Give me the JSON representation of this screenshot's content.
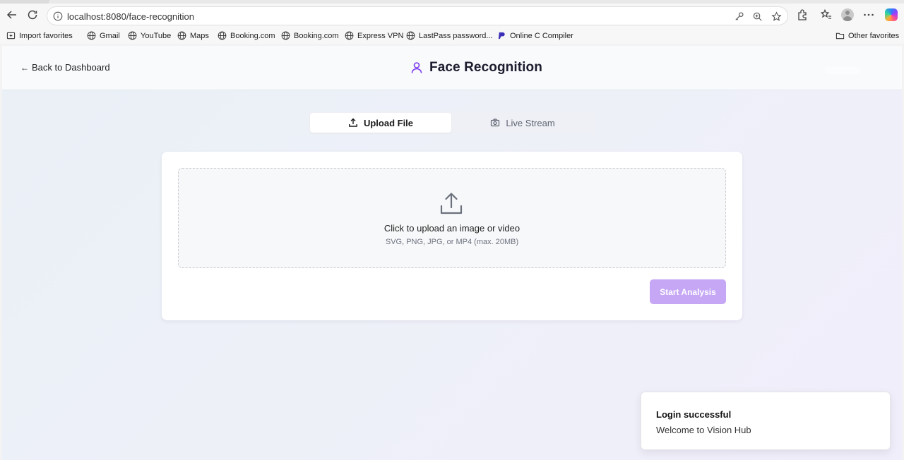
{
  "browser": {
    "url": "localhost:8080/face-recognition",
    "bookmarks": [
      {
        "label": "Import favorites",
        "icon": "import-icon"
      },
      {
        "label": "Gmail",
        "icon": "globe-icon"
      },
      {
        "label": "YouTube",
        "icon": "globe-icon"
      },
      {
        "label": "Maps",
        "icon": "globe-icon"
      },
      {
        "label": "Booking.com",
        "icon": "globe-icon"
      },
      {
        "label": "Booking.com",
        "icon": "globe-icon"
      },
      {
        "label": "Express VPN",
        "icon": "globe-icon"
      },
      {
        "label": "LastPass password...",
        "icon": "globe-icon"
      },
      {
        "label": "Online C Compiler",
        "icon": "p-logo-icon"
      }
    ],
    "other_favorites": "Other favorites"
  },
  "header": {
    "back_label": "Back to Dashboard",
    "title": "Face Recognition",
    "title_icon": "user-icon"
  },
  "tabs": [
    {
      "label": "Upload File",
      "icon": "upload-icon",
      "active": true
    },
    {
      "label": "Live Stream",
      "icon": "camera-icon",
      "active": false
    }
  ],
  "upload": {
    "title": "Click to upload an image or video",
    "subtitle": "SVG, PNG, JPG, or MP4 (max. 20MB)",
    "icon": "upload-icon"
  },
  "actions": {
    "start_label": "Start Analysis"
  },
  "toast": {
    "title": "Login successful",
    "description": "Welcome to Vision Hub"
  },
  "colors": {
    "accent": "#7c3aed",
    "button_disabled": "#c5a7f5"
  }
}
